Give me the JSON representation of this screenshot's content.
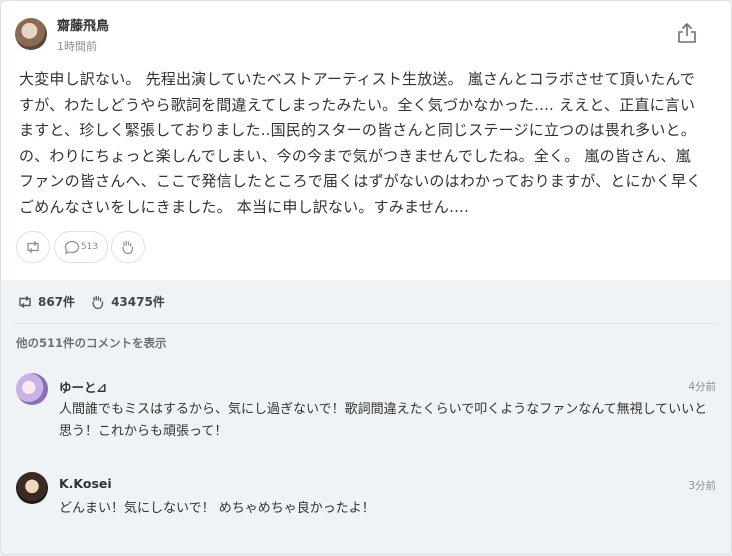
{
  "post": {
    "author": "齋藤飛鳥",
    "time": "1時間前",
    "body": "大変申し訳ない。 先程出演していたベストアーティスト生放送。 嵐さんとコラボさせて頂いたんですが、わたしどうやら歌詞を間違えてしまったみたい。全く気づかなかった.... ええと、正直に言いますと、珍しく緊張しておりました..国民的スターの皆さんと同じステージに立つのは畏れ多いと。 の、わりにちょっと楽しんでしまい、今の今まで気がつきませんでしたね。全く。 嵐の皆さん、嵐ファンの皆さんへ、ここで発信したところで届くはずがないのはわかっておりますが、とにかく早くごめんなさいをしにきました。 本当に申し訳ない。すみません....",
    "reply_count": "513"
  },
  "stats": {
    "retweets": "867件",
    "likes": "43475件"
  },
  "more_comments": "他の511件のコメントを表示",
  "comments": [
    {
      "name": "ゆーと⊿",
      "time": "4分前",
      "text": "人間誰でもミスはするから、気にし過ぎないで！歌詞間違えたくらいで叩くようなファンなんて無視していいと思う！これからも頑張って！"
    },
    {
      "name": "K.Kosei",
      "time": "3分前",
      "text": "どんまい！気にしないで！ めちゃめちゃ良かったよ！"
    }
  ],
  "icons": {
    "share": "share-icon",
    "retweet": "retweet-icon",
    "reply": "comment-icon",
    "clap": "clap-icon"
  }
}
